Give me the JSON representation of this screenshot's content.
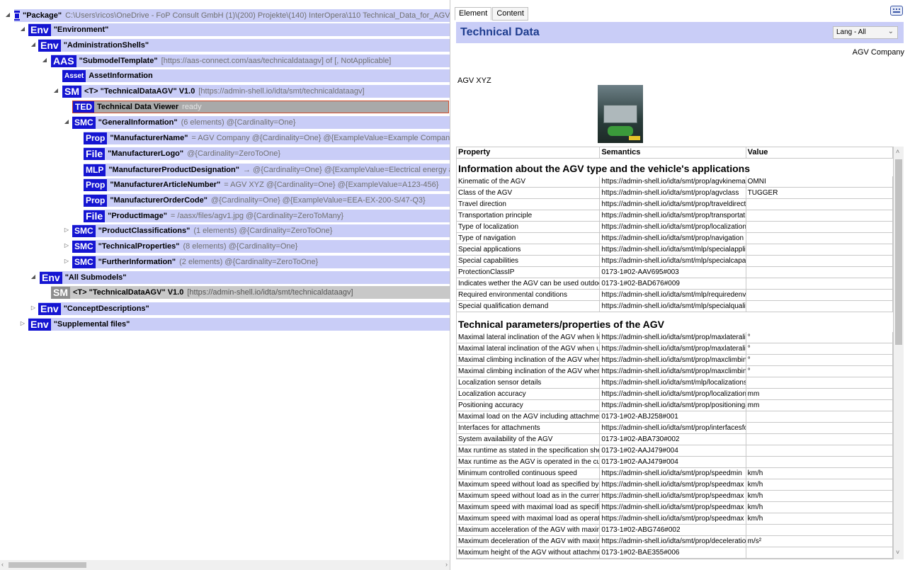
{
  "tree": {
    "package": {
      "name": "\"Package\"",
      "info": "C:\\Users\\ricos\\OneDrive - FoP Consult GmbH (1)\\(200) Projekte\\(140) InterOpera\\110 Technical_Data_for_AGV_in_Intralo"
    },
    "environment": {
      "badge": "Env",
      "name": "\"Environment\""
    },
    "admin_shells": {
      "badge": "Env",
      "name": "\"AdministrationShells\""
    },
    "aas": {
      "badge": "AAS",
      "name": "\"SubmodelTemplate\"",
      "info": "[https://aas-connect.com/aas/technicaldataagv] of [, NotApplicable]"
    },
    "asset": {
      "badge": "Asset",
      "name": "AssetInformation"
    },
    "sm": {
      "badge": "SM",
      "name": "<T> \"TechnicalDataAGV\" V1.0",
      "info": "[https://admin-shell.io/idta/smt/technicaldataagv]"
    },
    "ted": {
      "badge": "TED",
      "name": "Technical Data Viewer",
      "info": "ready"
    },
    "smc_general": {
      "badge": "SMC",
      "name": "\"GeneralInformation\"",
      "info": "(6 elements) @{Cardinality=One}"
    },
    "prop_manufacturer": {
      "badge": "Prop",
      "name": "\"ManufacturerName\"",
      "info": "= AGV Company @{Cardinality=One} @{ExampleValue=Example Company}"
    },
    "file_logo": {
      "badge": "File",
      "name": "\"ManufacturerLogo\"",
      "info": "@{Cardinality=ZeroToOne}"
    },
    "mlp_designation": {
      "badge": "MLP",
      "name": "\"ManufacturerProductDesignation\"",
      "info": "→ @{Cardinality=One} @{ExampleValue=Electrical energy accelerator"
    },
    "prop_article": {
      "badge": "Prop",
      "name": "\"ManufacturerArticleNumber\"",
      "info": "= AGV XYZ @{Cardinality=One} @{ExampleValue=A123-456}"
    },
    "prop_order": {
      "badge": "Prop",
      "name": "\"ManufacturerOrderCode\"",
      "info": "@{Cardinality=One} @{ExampleValue=EEA-EX-200-S/47-Q3}"
    },
    "file_image": {
      "badge": "File",
      "name": "\"ProductImage\"",
      "info": "= /aasx/files/agv1.jpg @{Cardinality=ZeroToMany}"
    },
    "smc_class": {
      "badge": "SMC",
      "name": "\"ProductClassifications\"",
      "info": "(1 elements) @{Cardinality=ZeroToOne}"
    },
    "smc_tech": {
      "badge": "SMC",
      "name": "\"TechnicalProperties\"",
      "info": "(8 elements) @{Cardinality=One}"
    },
    "smc_further": {
      "badge": "SMC",
      "name": "\"FurtherInformation\"",
      "info": "(2 elements) @{Cardinality=ZeroToOne}"
    },
    "all_submodels": {
      "badge": "Env",
      "name": "\"All Submodels\""
    },
    "sm2": {
      "badge": "SM",
      "name": "<T> \"TechnicalDataAGV\" V1.0",
      "info": "[https://admin-shell.io/idta/smt/technicaldataagv]"
    },
    "concepts": {
      "badge": "Env",
      "name": "\"ConceptDescriptions\""
    },
    "supplemental": {
      "badge": "Env",
      "name": "\"Supplemental files\""
    }
  },
  "right": {
    "tabs": [
      "Element",
      "Content"
    ],
    "title": "Technical Data",
    "lang": "Lang - All",
    "company": "AGV Company",
    "product": "AGV XYZ",
    "headers": [
      "Property",
      "Semantics",
      "Value"
    ],
    "sections": [
      {
        "title": "Information about the AGV type and the vehicle's applications",
        "rows": [
          [
            "Kinematic of the AGV",
            "https://admin-shell.io/idta/smt/prop/agvkinematic",
            "OMNI"
          ],
          [
            "Class of the AGV",
            "https://admin-shell.io/idta/smt/prop/agvclass",
            "TUGGER"
          ],
          [
            "Travel direction",
            "https://admin-shell.io/idta/smt/prop/traveldirection",
            ""
          ],
          [
            "Transportation principle",
            "https://admin-shell.io/idta/smt/prop/transportationprinciple",
            ""
          ],
          [
            "Type of localization",
            "https://admin-shell.io/idta/smt/prop/localization",
            ""
          ],
          [
            "Type of navigation",
            "https://admin-shell.io/idta/smt/prop/navigation",
            ""
          ],
          [
            "Special applications",
            "https://admin-shell.io/idta/smt/mlp/specialapplications",
            ""
          ],
          [
            "Special capabilities",
            "https://admin-shell.io/idta/smt/mlp/specialcapabilities",
            ""
          ],
          [
            "ProtectionClassIP",
            "0173-1#02-AAV695#003",
            ""
          ],
          [
            "Indicates wether the AGV can be used outdoors",
            "0173-1#02-BAD676#009",
            ""
          ],
          [
            "Required environmental conditions",
            "https://admin-shell.io/idta/smt/mlp/requiredenvironmentalconditions",
            ""
          ],
          [
            "Special qualification demand",
            "https://admin-shell.io/idta/smt/mlp/specialqualificationdemand",
            ""
          ]
        ]
      },
      {
        "title": "Technical parameters/properties of the AGV",
        "rows": [
          [
            "Maximal lateral inclination of the AGV when loaded",
            "https://admin-shell.io/idta/smt/prop/maxlateralinclinationloaded",
            "°"
          ],
          [
            "Maximal lateral inclination of the AGV when unloaded",
            "https://admin-shell.io/idta/smt/prop/maxlateralinclinationunloaded",
            "°"
          ],
          [
            "Maximal climbing inclination of the AGV when loaded",
            "https://admin-shell.io/idta/smt/prop/maxclimbinginclinationloaded",
            "°"
          ],
          [
            "Maximal climbing inclination of the AGV when unloaded",
            "https://admin-shell.io/idta/smt/prop/maxclimbinginclinationunloaded",
            "°"
          ],
          [
            "Localization sensor details",
            "https://admin-shell.io/idta/smt/mlp/localizationsensordetails",
            ""
          ],
          [
            "Localization accuracy",
            "https://admin-shell.io/idta/smt/prop/localizationaccuracy",
            "mm"
          ],
          [
            "Positioning accuracy",
            "https://admin-shell.io/idta/smt/prop/positioningaccuracy",
            "mm"
          ],
          [
            "Maximal load on the AGV including attachments",
            "0173-1#02-ABJ258#001",
            ""
          ],
          [
            "Interfaces for attachments",
            "https://admin-shell.io/idta/smt/prop/interfacesforattachments",
            ""
          ],
          [
            "System availability of the AGV",
            "0173-1#02-ABA730#002",
            ""
          ],
          [
            "Max runtime as stated in the specification sheet",
            "0173-1#02-AAJ479#004",
            ""
          ],
          [
            "Max runtime as the AGV is operated in the current",
            "0173-1#02-AAJ479#004",
            ""
          ],
          [
            "Minimum controlled continuous speed",
            "https://admin-shell.io/idta/smt/prop/speedmin",
            "km/h"
          ],
          [
            "Maximum speed without load as specified by",
            "https://admin-shell.io/idta/smt/prop/speedmax",
            "km/h"
          ],
          [
            "Maximum speed without load as in the current",
            "https://admin-shell.io/idta/smt/prop/speedmax",
            "km/h"
          ],
          [
            "Maximum speed with maximal load as specified",
            "https://admin-shell.io/idta/smt/prop/speedmax",
            "km/h"
          ],
          [
            "Maximum speed with maximal load as operated",
            "https://admin-shell.io/idta/smt/prop/speedmax",
            "km/h"
          ],
          [
            "Maximum acceleration of the AGV with maximal load",
            "0173-1#02-ABG746#002",
            ""
          ],
          [
            "Maximum deceleration of the AGV with maximal load",
            "https://admin-shell.io/idta/smt/prop/deceleration",
            "m/s²"
          ],
          [
            "Maximum height of the AGV without attachments",
            "0173-1#02-BAE355#006",
            ""
          ]
        ]
      }
    ]
  }
}
